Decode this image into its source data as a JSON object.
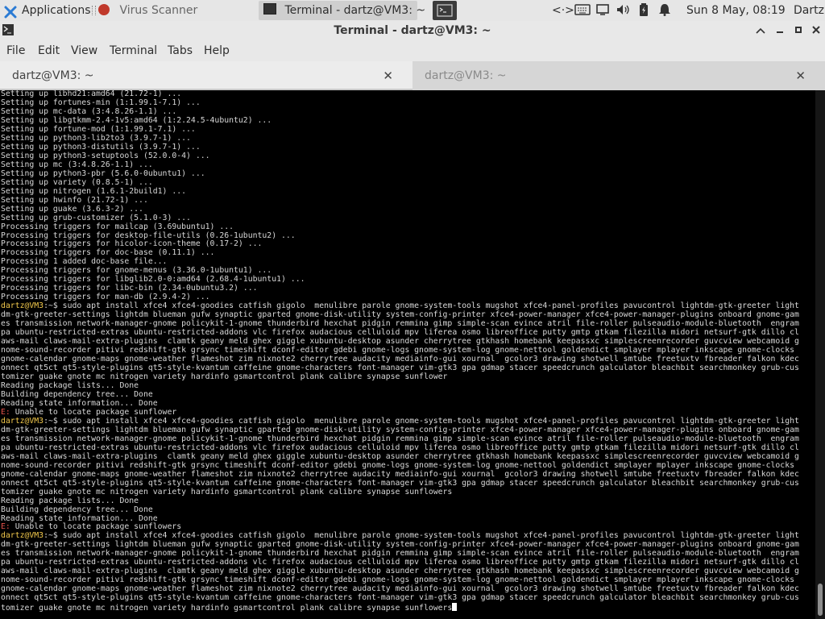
{
  "panel": {
    "applications_label": "Applications",
    "task_virus": "Virus Scanner",
    "task_terminal": "Terminal - dartz@VM3: ~",
    "clock": "Sun  8 May, 08:19",
    "user": "Dartz",
    "icons": [
      "xfce-logo-icon",
      "virus-scanner-icon",
      "terminal-icon",
      "network-icon",
      "keyboard-icon",
      "display-icon",
      "volume-icon",
      "battery-icon",
      "notifications-icon"
    ]
  },
  "window": {
    "title": "Terminal - dartz@VM3: ~",
    "buttons": [
      "minimize",
      "maximize",
      "close"
    ]
  },
  "menubar": [
    "File",
    "Edit",
    "View",
    "Terminal",
    "Tabs",
    "Help"
  ],
  "tabs": [
    {
      "label": "dartz@VM3: ~",
      "active": true
    },
    {
      "label": "dartz@VM3: ~",
      "active": false
    }
  ],
  "terminal": {
    "lines": [
      {
        "t": "Setting up libhd21:amd64 (21.72-1) ..."
      },
      {
        "t": "Setting up fortunes-min (1:1.99.1-7.1) ..."
      },
      {
        "t": "Setting up mc-data (3:4.8.26-1.1) ..."
      },
      {
        "t": "Setting up libgtkmm-2.4-1v5:amd64 (1:2.24.5-4ubuntu2) ..."
      },
      {
        "t": "Setting up fortune-mod (1:1.99.1-7.1) ..."
      },
      {
        "t": "Setting up python3-lib2to3 (3.9.7-1) ..."
      },
      {
        "t": "Setting up python3-distutils (3.9.7-1) ..."
      },
      {
        "t": "Setting up python3-setuptools (52.0.0-4) ..."
      },
      {
        "t": "Setting up mc (3:4.8.26-1.1) ..."
      },
      {
        "t": "Setting up python3-pbr (5.6.0-0ubuntu1) ..."
      },
      {
        "t": "Setting up variety (0.8.5-1) ..."
      },
      {
        "t": "Setting up nitrogen (1.6.1-2build1) ..."
      },
      {
        "t": "Setting up hwinfo (21.72-1) ..."
      },
      {
        "t": "Setting up guake (3.6.3-2) ..."
      },
      {
        "t": "Setting up grub-customizer (5.1.0-3) ..."
      },
      {
        "t": "Processing triggers for mailcap (3.69ubuntu1) ..."
      },
      {
        "t": "Processing triggers for desktop-file-utils (0.26-1ubuntu2) ..."
      },
      {
        "t": "Processing triggers for hicolor-icon-theme (0.17-2) ..."
      },
      {
        "t": "Processing triggers for doc-base (0.11.1) ..."
      },
      {
        "t": "Processing 1 added doc-base file..."
      },
      {
        "t": "Processing triggers for gnome-menus (3.36.0-1ubuntu1) ..."
      },
      {
        "t": "Processing triggers for libglib2.0-0:amd64 (2.68.4-1ubuntu1) ..."
      },
      {
        "t": "Processing triggers for libc-bin (2.34-0ubuntu3.2) ..."
      },
      {
        "t": "Processing triggers for man-db (2.9.4-2) ..."
      },
      {
        "p": "dartz@VM3",
        "t": ":~$ sudo apt install xfce4 xfce4-goodies catfish gigolo  menulibre parole gnome-system-tools mugshot xfce4-panel-profiles pavucontrol lightdm-gtk-greeter light"
      },
      {
        "t": "dm-gtk-greeter-settings lightdm blueman gufw synaptic gparted gnome-disk-utility system-config-printer xfce4-power-manager xfce4-power-manager-plugins onboard gnome-gam"
      },
      {
        "t": "es transmission network-manager-gnome policykit-1-gnome thunderbird hexchat pidgin remmina gimp simple-scan evince atril file-roller pulseaudio-module-bluetooth  engram"
      },
      {
        "t": "pa ubuntu-restricted-extras ubuntu-restricted-addons vlc firefox audacious celluloid mpv liferea osmo libreoffice putty gmtp gtkam filezilla midori netsurf-gtk dillo cl"
      },
      {
        "t": "aws-mail claws-mail-extra-plugins  clamtk geany meld ghex giggle xubuntu-desktop asunder cherrytree gtkhash homebank keepassxc simplescreenrecorder guvcview webcamoid g"
      },
      {
        "t": "nome-sound-recorder pitivi redshift-gtk grsync timeshift dconf-editor gdebi gnome-logs gnome-system-log gnome-nettool goldendict smplayer mplayer inkscape gnome-clocks"
      },
      {
        "t": "gnome-calendar gnome-maps gnome-weather flameshot zim nixnote2 cherrytree audacity mediainfo-gui xournal  gcolor3 drawing shotwell smtube freetuxtv fbreader falkon kdec"
      },
      {
        "t": "onnect qt5ct qt5-style-plugins qt5-style-kvantum caffeine gnome-characters font-manager vim-gtk3 gpa gdmap stacer speedcrunch galculator bleachbit searchmonkey grub-cus"
      },
      {
        "t": "tomizer guake gnote mc nitrogen variety hardinfo gsmartcontrol plank calibre synapse sunflower"
      },
      {
        "t": "Reading package lists... Done"
      },
      {
        "t": "Building dependency tree... Done"
      },
      {
        "t": "Reading state information... Done"
      },
      {
        "e": "E:",
        "t": " Unable to locate package sunflower"
      },
      {
        "p": "dartz@VM3",
        "t": ":~$ sudo apt install xfce4 xfce4-goodies catfish gigolo  menulibre parole gnome-system-tools mugshot xfce4-panel-profiles pavucontrol lightdm-gtk-greeter light"
      },
      {
        "t": "dm-gtk-greeter-settings lightdm blueman gufw synaptic gparted gnome-disk-utility system-config-printer xfce4-power-manager xfce4-power-manager-plugins onboard gnome-gam"
      },
      {
        "t": "es transmission network-manager-gnome policykit-1-gnome thunderbird hexchat pidgin remmina gimp simple-scan evince atril file-roller pulseaudio-module-bluetooth  engram"
      },
      {
        "t": "pa ubuntu-restricted-extras ubuntu-restricted-addons vlc firefox audacious celluloid mpv liferea osmo libreoffice putty gmtp gtkam filezilla midori netsurf-gtk dillo cl"
      },
      {
        "t": "aws-mail claws-mail-extra-plugins  clamtk geany meld ghex giggle xubuntu-desktop asunder cherrytree gtkhash homebank keepassxc simplescreenrecorder guvcview webcamoid g"
      },
      {
        "t": "nome-sound-recorder pitivi redshift-gtk grsync timeshift dconf-editor gdebi gnome-logs gnome-system-log gnome-nettool goldendict smplayer mplayer inkscape gnome-clocks"
      },
      {
        "t": "gnome-calendar gnome-maps gnome-weather flameshot zim nixnote2 cherrytree audacity mediainfo-gui xournal  gcolor3 drawing shotwell smtube freetuxtv fbreader falkon kdec"
      },
      {
        "t": "onnect qt5ct qt5-style-plugins qt5-style-kvantum caffeine gnome-characters font-manager vim-gtk3 gpa gdmap stacer speedcrunch galculator bleachbit searchmonkey grub-cus"
      },
      {
        "t": "tomizer guake gnote mc nitrogen variety hardinfo gsmartcontrol plank calibre synapse sunflowers"
      },
      {
        "t": "Reading package lists... Done"
      },
      {
        "t": "Building dependency tree... Done"
      },
      {
        "t": "Reading state information... Done"
      },
      {
        "e": "E:",
        "t": " Unable to locate package sunflowers"
      },
      {
        "p": "dartz@VM3",
        "t": ":~$ sudo apt install xfce4 xfce4-goodies catfish gigolo  menulibre parole gnome-system-tools mugshot xfce4-panel-profiles pavucontrol lightdm-gtk-greeter light"
      },
      {
        "t": "dm-gtk-greeter-settings lightdm blueman gufw synaptic gparted gnome-disk-utility system-config-printer xfce4-power-manager xfce4-power-manager-plugins onboard gnome-gam"
      },
      {
        "t": "es transmission network-manager-gnome policykit-1-gnome thunderbird hexchat pidgin remmina gimp simple-scan evince atril file-roller pulseaudio-module-bluetooth  engram"
      },
      {
        "t": "pa ubuntu-restricted-extras ubuntu-restricted-addons vlc firefox audacious celluloid mpv liferea osmo libreoffice putty gmtp gtkam filezilla midori netsurf-gtk dillo cl"
      },
      {
        "t": "aws-mail claws-mail-extra-plugins  clamtk geany meld ghex giggle xubuntu-desktop asunder cherrytree gtkhash homebank keepassxc simplescreenrecorder guvcview webcamoid g"
      },
      {
        "t": "nome-sound-recorder pitivi redshift-gtk grsync timeshift dconf-editor gdebi gnome-logs gnome-system-log gnome-nettool goldendict smplayer mplayer inkscape gnome-clocks"
      },
      {
        "t": "gnome-calendar gnome-maps gnome-weather flameshot zim nixnote2 cherrytree audacity mediainfo-gui xournal  gcolor3 drawing shotwell smtube freetuxtv fbreader falkon kdec"
      },
      {
        "t": "onnect qt5ct qt5-style-plugins qt5-style-kvantum caffeine gnome-characters font-manager vim-gtk3 gpa gdmap stacer speedcrunch galculator bleachbit searchmonkey grub-cus"
      },
      {
        "t": "tomizer guake gnote mc nitrogen variety hardinfo gsmartcontrol plank calibre synapse sunflowers",
        "cursor": true
      }
    ]
  },
  "colors": {
    "terminal_bg": "#000000",
    "terminal_fg": "#d8d8d8",
    "prompt_user": "#f2c94c",
    "error": "#e5534b",
    "panel_bg": "#e6e6e6",
    "xfce_blue": "#2b7bd4"
  }
}
